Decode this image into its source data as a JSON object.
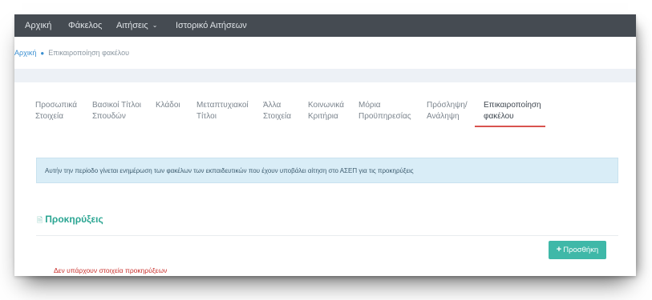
{
  "navbar": {
    "items": [
      {
        "label": "Αρχική"
      },
      {
        "label": "Φάκελος"
      },
      {
        "label": "Αιτήσεις"
      },
      {
        "label": "Ιστορικό Αιτήσεων"
      }
    ]
  },
  "breadcrumb": {
    "home": "Αρχική",
    "separator": "●",
    "current": "Επικαιροποίηση φακέλου"
  },
  "tabs": [
    {
      "line1": "Προσωπικά",
      "line2": "Στοιχεία"
    },
    {
      "line1": "Βασικοί Τίτλοι",
      "line2": "Σπουδών"
    },
    {
      "line1": "Κλάδοι",
      "line2": ""
    },
    {
      "line1": "Μεταπτυχιακοί",
      "line2": "Τίτλοι"
    },
    {
      "line1": "Άλλα",
      "line2": "Στοιχεία"
    },
    {
      "line1": "Κοινωνικά",
      "line2": "Κριτήρια"
    },
    {
      "line1": "Μόρια",
      "line2": "Προϋπηρεσίας"
    },
    {
      "line1": "Πρόσληψη/",
      "line2": "Ανάληψη"
    },
    {
      "line1": "Επικαιροποίηση",
      "line2": "φακέλου"
    }
  ],
  "active_tab_index": 8,
  "info_message": "Αυτήν την περίοδο γίνεται ενημέρωση των φακέλων των εκπαιδευτικών που έχουν υποβάλει αίτηση στο ΑΣΕΠ για τις προκηρύξεις",
  "section": {
    "title": "Προκηρύξεις",
    "add_button": "Προσθήκη",
    "empty_message": "Δεν υπάρχουν στοιχεία προκηρύξεων"
  },
  "colors": {
    "navbar": "#454b52",
    "accent": "#3fb8a8",
    "active_tab_underline": "#d9534f",
    "info_bg": "#d9edf7",
    "error_text": "#c9302c"
  },
  "icons": {
    "dropdown": "chevron-down-icon",
    "section": "document-icon",
    "add": "plus-icon",
    "breadcrumb_separator": "dot-icon"
  }
}
